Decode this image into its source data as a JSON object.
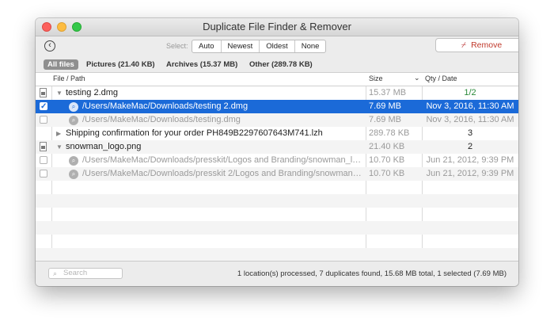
{
  "window": {
    "title": "Duplicate File Finder & Remover"
  },
  "toolbar": {
    "back_icon": "back-arrow-circle-icon",
    "select_label": "Select:",
    "select_options": [
      "Auto",
      "Newest",
      "Oldest",
      "None"
    ],
    "remove_label": "Remove",
    "remove_icon": "broom-icon"
  },
  "filters": [
    {
      "label": "All files",
      "active": true
    },
    {
      "label": "Pictures (21.40 KB)",
      "active": false
    },
    {
      "label": "Archives (15.37 MB)",
      "active": false
    },
    {
      "label": "Other (289.78 KB)",
      "active": false
    }
  ],
  "table": {
    "headers": {
      "path": "File / Path",
      "size": "Size",
      "size_sort": "chevron-down-icon",
      "qty": "Qty / Date"
    },
    "rows": [
      {
        "kind": "group",
        "name": "testing 2.dmg",
        "size": "15.37 MB",
        "qty": "1/2",
        "expanded": true
      },
      {
        "kind": "file",
        "checked": true,
        "selected": true,
        "path": "/Users/MakeMac/Downloads/testing 2.dmg",
        "size": "7.69 MB",
        "date": "Nov 3, 2016, 11:30 AM"
      },
      {
        "kind": "file",
        "checked": false,
        "selected": false,
        "path": "/Users/MakeMac/Downloads/testing.dmg",
        "size": "7.69 MB",
        "date": "Nov 3, 2016, 11:30 AM"
      },
      {
        "kind": "group",
        "name": "Shipping confirmation for your order PH849B2297607643M741.lzh",
        "size": "289.78 KB",
        "qty": "3",
        "expanded": false
      },
      {
        "kind": "group",
        "name": "snowman_logo.png",
        "size": "21.40 KB",
        "qty": "2",
        "expanded": true
      },
      {
        "kind": "file",
        "checked": false,
        "selected": false,
        "path": "/Users/MakeMac/Downloads/presskit/Logos and Branding/snowman_lo...",
        "size": "10.70 KB",
        "date": "Jun 21, 2012, 9:39 PM"
      },
      {
        "kind": "file",
        "checked": false,
        "selected": false,
        "path": "/Users/MakeMac/Downloads/presskit 2/Logos and Branding/snowman_l...",
        "size": "10.70 KB",
        "date": "Jun 21, 2012, 9:39 PM"
      }
    ]
  },
  "footer": {
    "search_placeholder": "Search",
    "status": "1 location(s) processed, 7 duplicates found, 15.68 MB total, 1 selected (7.69 MB)"
  }
}
